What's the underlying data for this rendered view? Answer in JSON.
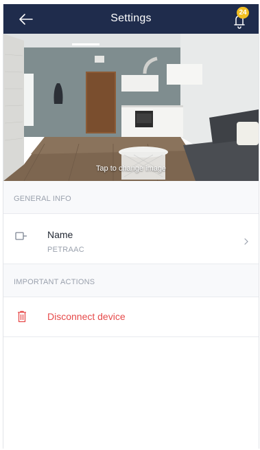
{
  "header": {
    "title": "Settings",
    "notification_count": "24",
    "back_icon": "arrow-left-icon",
    "bell_icon": "bell-icon"
  },
  "photo": {
    "caption": "Tap to change image"
  },
  "general_info": {
    "section_label": "GENERAL INFO",
    "name_row": {
      "icon": "device-icon",
      "label": "Name",
      "value": "PETRAAC"
    }
  },
  "important_actions": {
    "section_label": "IMPORTANT ACTIONS",
    "disconnect_row": {
      "icon": "trash-icon",
      "label": "Disconnect device"
    }
  },
  "colors": {
    "header_bg": "#1f2c4c",
    "badge": "#f2bf21",
    "danger": "#e64a4a",
    "muted_text": "#9aa1ad"
  }
}
